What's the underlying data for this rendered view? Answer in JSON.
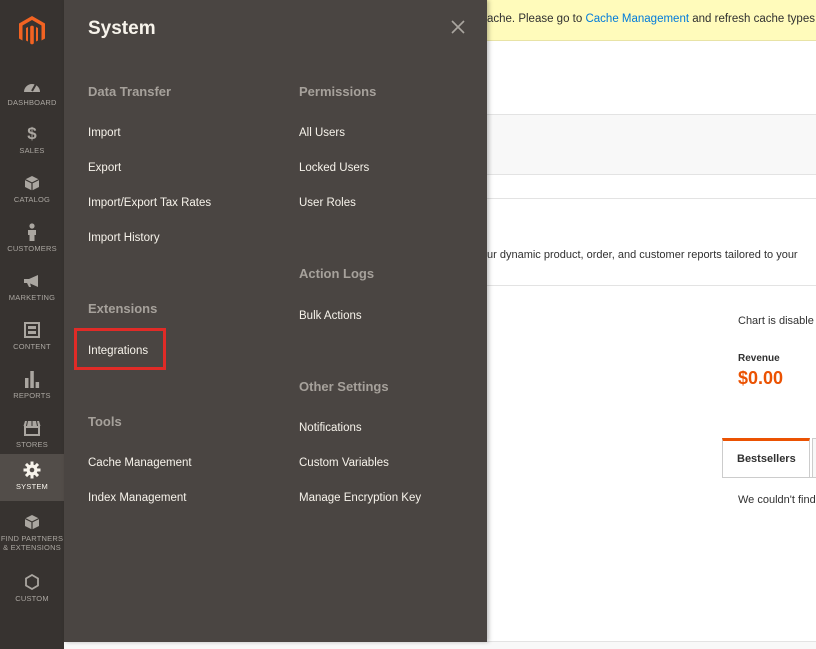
{
  "sidebar": {
    "items": [
      {
        "label": "DASHBOARD",
        "icon": "dashboard-icon"
      },
      {
        "label": "SALES",
        "icon": "dollar-icon"
      },
      {
        "label": "CATALOG",
        "icon": "box-icon"
      },
      {
        "label": "CUSTOMERS",
        "icon": "person-icon"
      },
      {
        "label": "MARKETING",
        "icon": "megaphone-icon"
      },
      {
        "label": "CONTENT",
        "icon": "layout-icon"
      },
      {
        "label": "REPORTS",
        "icon": "bar-chart-icon"
      },
      {
        "label": "STORES",
        "icon": "storefront-icon"
      },
      {
        "label": "SYSTEM",
        "icon": "gear-icon"
      },
      {
        "label": "FIND PARTNERS & EXTENSIONS",
        "icon": "cube-icon"
      },
      {
        "label": "CUSTOM",
        "icon": "hexagon-icon"
      }
    ],
    "active": "SYSTEM"
  },
  "colors": {
    "sidebar_bg": "#373330",
    "panel_bg": "#4a4542",
    "accent": "#eb5202",
    "highlight_box": "#e02b27",
    "link": "#007bdb"
  },
  "panel": {
    "title": "System",
    "data_transfer": {
      "heading": "Data Transfer",
      "links": [
        "Import",
        "Export",
        "Import/Export Tax Rates",
        "Import History"
      ]
    },
    "extensions": {
      "heading": "Extensions",
      "links": [
        "Integrations"
      ]
    },
    "tools": {
      "heading": "Tools",
      "links": [
        "Cache Management",
        "Index Management"
      ]
    },
    "permissions": {
      "heading": "Permissions",
      "links": [
        "All Users",
        "Locked Users",
        "User Roles"
      ]
    },
    "action_logs": {
      "heading": "Action Logs",
      "links": [
        "Bulk Actions"
      ]
    },
    "other_settings": {
      "heading": "Other Settings",
      "links": [
        "Notifications",
        "Custom Variables",
        "Manage Encryption Key"
      ]
    }
  },
  "background": {
    "notice_prefix": "ache. Please go to ",
    "notice_link": "Cache Management",
    "notice_suffix": " and refresh cache types.",
    "intro_text": "ur dynamic product, order, and customer reports tailored to your",
    "chart_message": "Chart is disable",
    "revenue_label": "Revenue",
    "revenue_value": "$0.00",
    "tab_label": "Bestsellers",
    "no_data": "We couldn't find"
  }
}
